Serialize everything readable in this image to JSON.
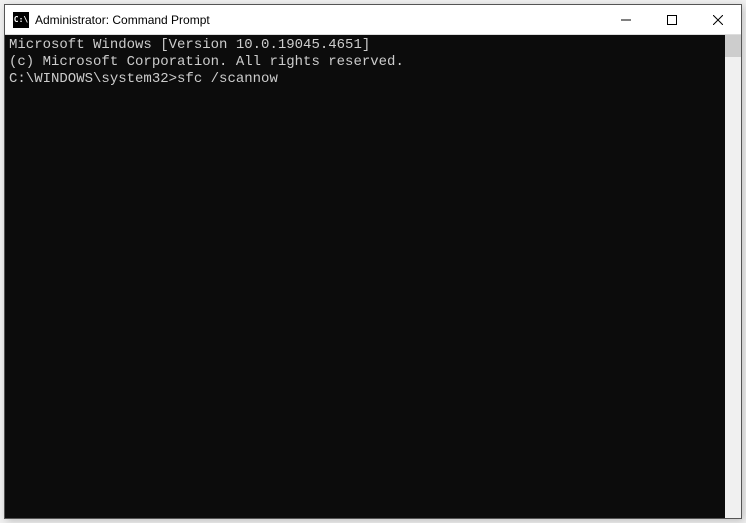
{
  "window": {
    "title": "Administrator: Command Prompt",
    "icon_text": "C:\\"
  },
  "terminal": {
    "line1": "Microsoft Windows [Version 10.0.19045.4651]",
    "line2": "(c) Microsoft Corporation. All rights reserved.",
    "blank": "",
    "prompt": "C:\\WINDOWS\\system32>",
    "command": "sfc /scannow"
  }
}
